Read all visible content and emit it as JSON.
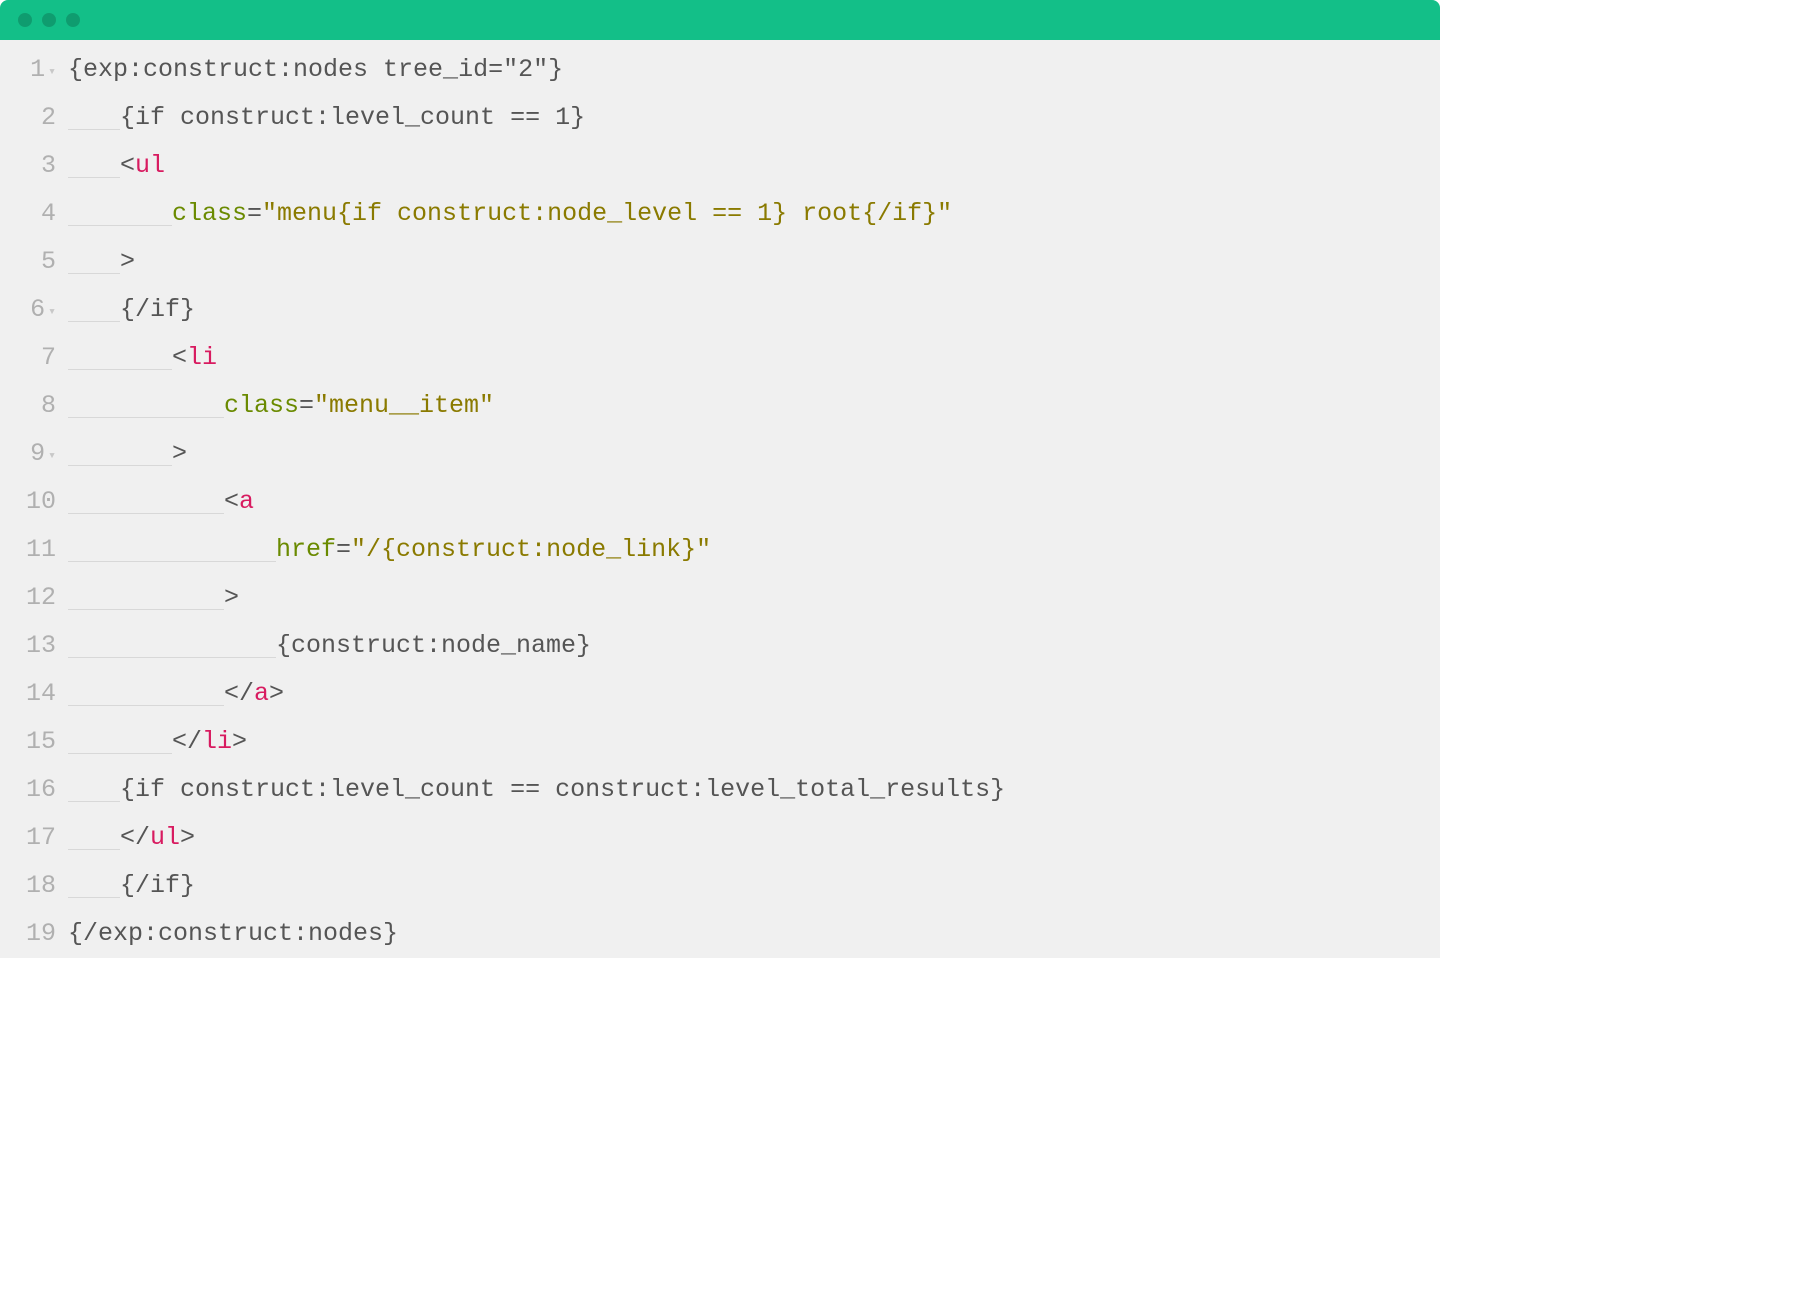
{
  "titlebar": {
    "color": "#13bf88"
  },
  "gutter": {
    "lines": [
      {
        "n": "1",
        "fold": true
      },
      {
        "n": "2",
        "fold": false
      },
      {
        "n": "3",
        "fold": false
      },
      {
        "n": "4",
        "fold": false
      },
      {
        "n": "5",
        "fold": false
      },
      {
        "n": "6",
        "fold": true
      },
      {
        "n": "7",
        "fold": false
      },
      {
        "n": "8",
        "fold": false
      },
      {
        "n": "9",
        "fold": true
      },
      {
        "n": "10",
        "fold": false
      },
      {
        "n": "11",
        "fold": false
      },
      {
        "n": "12",
        "fold": false
      },
      {
        "n": "13",
        "fold": false
      },
      {
        "n": "14",
        "fold": false
      },
      {
        "n": "15",
        "fold": false
      },
      {
        "n": "16",
        "fold": false
      },
      {
        "n": "17",
        "fold": false
      },
      {
        "n": "18",
        "fold": false
      },
      {
        "n": "19",
        "fold": false
      }
    ]
  },
  "code": {
    "l1": {
      "a": "{exp:construct:nodes tree_id=\"2\"}"
    },
    "l2": {
      "a": "{if construct:level_count == 1}"
    },
    "l3": {
      "a": "<",
      "b": "ul"
    },
    "l4": {
      "a": "class",
      "b": "=",
      "c": "\"menu{if construct:node_level == 1} root{/if}\""
    },
    "l5": {
      "a": ">"
    },
    "l6": {
      "a": "{/if}"
    },
    "l7": {
      "a": "<",
      "b": "li"
    },
    "l8": {
      "a": "class",
      "b": "=",
      "c": "\"menu__item\""
    },
    "l9": {
      "a": ">"
    },
    "l10": {
      "a": "<",
      "b": "a"
    },
    "l11": {
      "a": "href",
      "b": "=",
      "c": "\"/{construct:node_link}\""
    },
    "l12": {
      "a": ">"
    },
    "l13": {
      "a": "{construct:node_name}"
    },
    "l14": {
      "a": "</",
      "b": "a",
      "c": ">"
    },
    "l15": {
      "a": "</",
      "b": "li",
      "c": ">"
    },
    "l16": {
      "a": "{if construct:level_count == construct:level_total_results}"
    },
    "l17": {
      "a": "</",
      "b": "ul",
      "c": ">"
    },
    "l18": {
      "a": "{/if}"
    },
    "l19": {
      "a": "{/exp:construct:nodes}"
    }
  }
}
